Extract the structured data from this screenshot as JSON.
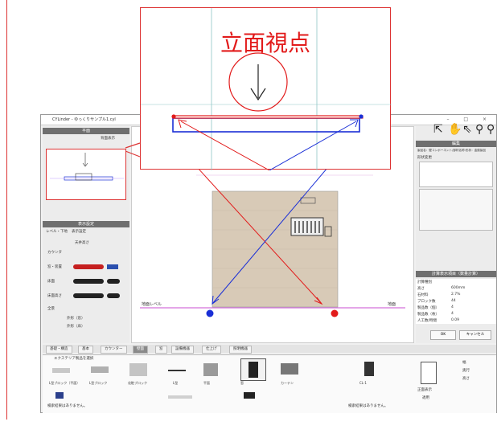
{
  "callout": {
    "title": "立面視点",
    "arrow_icon": "down-arrow-icon"
  },
  "window": {
    "title": "CYLinder - ゆっくりサンプル1.cyl",
    "controls": "–  □  ×"
  },
  "left_panel": {
    "top_section_title": "平面",
    "show_rear_label": "背面表示",
    "view_setting_title": "表示設定",
    "tabs": [
      "レベル・下地",
      "表示設定"
    ],
    "labels": [
      "天井高さ",
      "カウンタ",
      "窓・装置",
      "床面",
      "床面高さ",
      "全景",
      "外形（窓）",
      "外形（床）"
    ]
  },
  "right_panel": {
    "toolbar_icons": [
      "select-arrow-icon",
      "hand-pan-icon",
      "pointer-icon",
      "magnifier-icon",
      "magnifier-icon"
    ],
    "properties_title": "編集",
    "properties_subtitle": "製品名：壁コンポーネント/部材名称:形状：金属製品",
    "subtitle2": "形状変更",
    "data_section_title": "計算表示項目（数量計算）",
    "property_rows": [
      {
        "label": "計算種別",
        "value": ""
      },
      {
        "label": "高さ",
        "value": "600mm"
      },
      {
        "label": "石材料",
        "value": "2.7%"
      },
      {
        "label": "ブロック数",
        "value": "44"
      },
      {
        "label": "製品数（個）",
        "value": "4"
      },
      {
        "label": "製品数（枚）",
        "value": "4"
      },
      {
        "label": "人工数/時間",
        "value": "0.09"
      }
    ],
    "ok_label": "OK",
    "cancel_label": "キャンセル"
  },
  "canvas": {
    "level_label_left": "地面レベル",
    "level_label_right": "地面"
  },
  "bottom": {
    "tabs": [
      "基礎・構造",
      "基本",
      "カウンター",
      "壁面",
      "窓",
      "設備機器",
      "仕上げ",
      "照明機器"
    ],
    "active_tab": 3,
    "filter_label": "エクステリア製品を選択",
    "items": [
      {
        "label": "L型ブロック（平面）"
      },
      {
        "label": "L型ブロック"
      },
      {
        "label": "化粧ブロック"
      },
      {
        "label": "L型"
      },
      {
        "label": "平面"
      },
      {
        "label": "窓"
      },
      {
        "label": "カーテン"
      },
      {
        "label": "CL-1"
      }
    ],
    "status_left": "検索結果はありません。",
    "status_right": "検索結果はありません。",
    "side_labels": [
      "幅",
      "奥行",
      "高さ"
    ],
    "front_label": "正面表示",
    "apply_label": "適用"
  },
  "colors": {
    "accent_red": "#e21b1b",
    "accent_blue": "#1a2fd6",
    "wall_fill": "#d8cab7",
    "panel_header": "#6f6f6f"
  }
}
